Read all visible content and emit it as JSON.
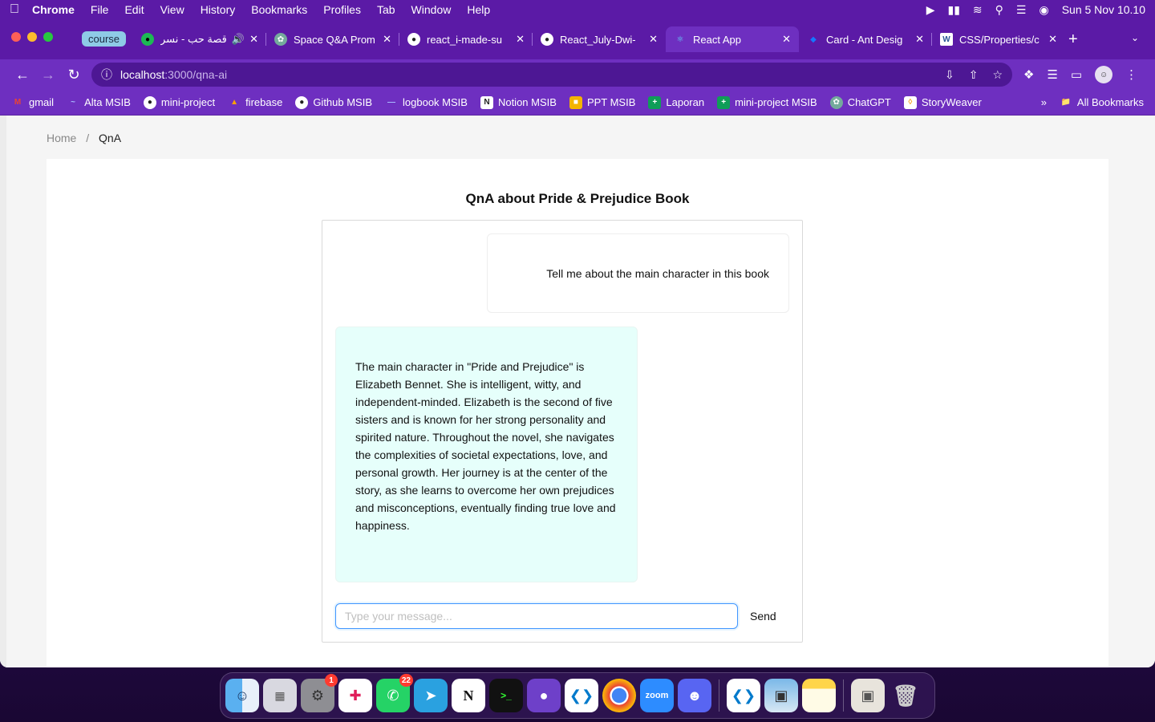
{
  "menubar": {
    "app": "Chrome",
    "items": [
      "File",
      "Edit",
      "View",
      "History",
      "Bookmarks",
      "Profiles",
      "Tab",
      "Window",
      "Help"
    ],
    "datetime": "Sun 5 Nov  10.10"
  },
  "tabs": {
    "group_label": "course",
    "items": [
      {
        "label": "قصة حب - نسر",
        "icon": "spotify-icon",
        "color": "#1db954"
      },
      {
        "label": "Space Q&A Prom",
        "icon": "openai-icon",
        "color": "#74aa9c"
      },
      {
        "label": "react_i-made-su",
        "icon": "github-icon",
        "color": "#222222"
      },
      {
        "label": "React_July-Dwi-",
        "icon": "github-icon",
        "color": "#222222"
      },
      {
        "label": "React App",
        "icon": "react-icon",
        "color": "#61dafb"
      },
      {
        "label": "Card - Ant Desig",
        "icon": "antd-icon",
        "color": "#1677ff"
      },
      {
        "label": "CSS/Properties/c",
        "icon": "w3-icon",
        "color": "#2b5797"
      }
    ],
    "active_index": 4
  },
  "address": {
    "host": "localhost",
    "path": ":3000/qna-ai"
  },
  "bookmarks": [
    {
      "label": "gmail",
      "color": "#ea4335",
      "glyph": "M"
    },
    {
      "label": "Alta MSIB",
      "color": "#2b3a8c",
      "glyph": "~"
    },
    {
      "label": "mini-project",
      "color": "#222222",
      "glyph": "●"
    },
    {
      "label": "firebase",
      "color": "#ffa000",
      "glyph": "▲"
    },
    {
      "label": "Github MSIB",
      "color": "#222222",
      "glyph": "●"
    },
    {
      "label": "logbook MSIB",
      "color": "#3a5aa8",
      "glyph": "—"
    },
    {
      "label": "Notion MSIB",
      "color": "#222222",
      "glyph": "N"
    },
    {
      "label": "PPT MSIB",
      "color": "#f4b400",
      "glyph": "■"
    },
    {
      "label": "Laporan",
      "color": "#0f9d58",
      "glyph": "+"
    },
    {
      "label": "mini-project MSIB",
      "color": "#0f9d58",
      "glyph": "+"
    },
    {
      "label": "ChatGPT",
      "color": "#74aa9c",
      "glyph": "◎"
    },
    {
      "label": "StoryWeaver",
      "color": "#f5d76e",
      "glyph": "◊"
    }
  ],
  "bookmarks_more": "»",
  "all_bookmarks": "All Bookmarks",
  "breadcrumb": {
    "home": "Home",
    "separator": "/",
    "current": "QnA"
  },
  "qna": {
    "title": "QnA about Pride & Prejudice Book",
    "user_message": "Tell me about the main character in this book",
    "ai_message": "The main character in \"Pride and Prejudice\" is Elizabeth Bennet. She is intelligent, witty, and independent-minded. Elizabeth is the second of five sisters and is known for her strong personality and spirited nature. Throughout the novel, she navigates the complexities of societal expectations, love, and personal growth. Her journey is at the center of the story, as she learns to overcome her own prejudices and misconceptions, eventually finding true love and happiness.",
    "input_placeholder": "Type your message...",
    "send_label": "Send"
  },
  "dock": {
    "badges": {
      "settings": "1",
      "whatsapp": "22"
    },
    "zoom_label": "zoom"
  }
}
